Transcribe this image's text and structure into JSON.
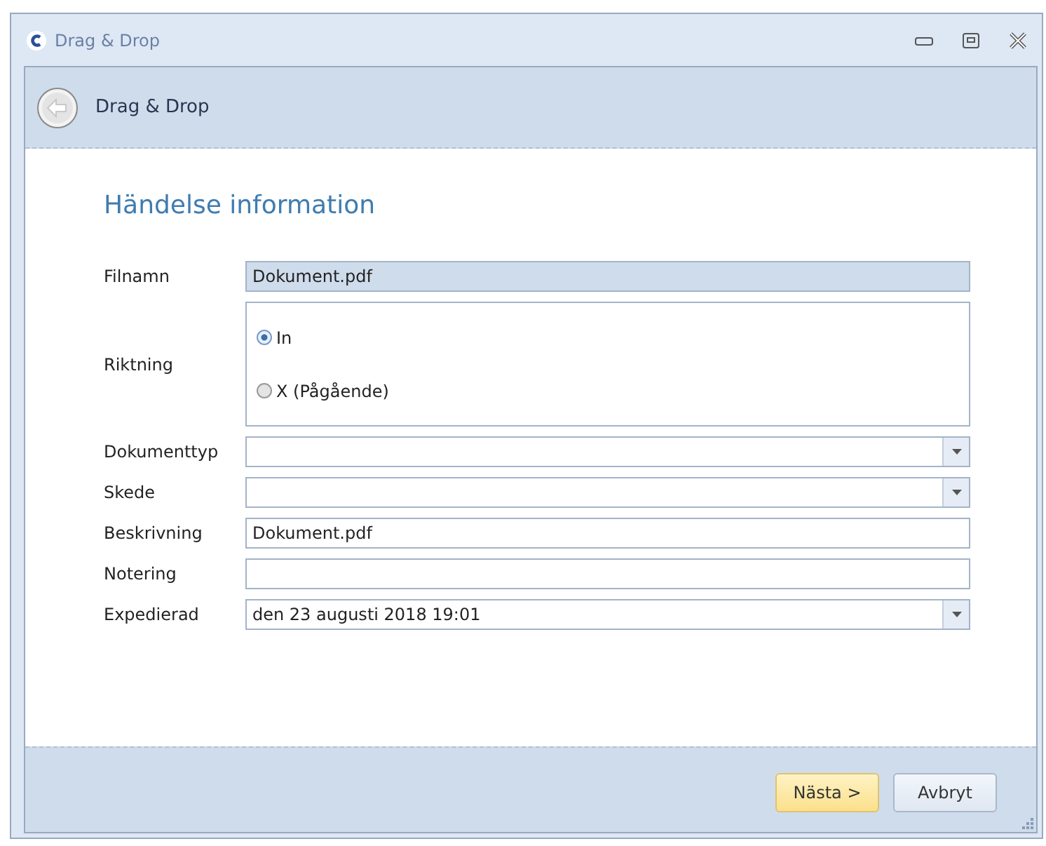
{
  "window": {
    "title": "Drag & Drop"
  },
  "header": {
    "title": "Drag & Drop"
  },
  "section_title": "Händelse information",
  "fields": [
    {
      "label": "Filnamn",
      "kind": "readonly",
      "value": "Dokument.pdf"
    },
    {
      "label": "Riktning",
      "kind": "radio",
      "options": [
        {
          "label": "In",
          "selected": true
        },
        {
          "label": "X (Pågående)",
          "selected": false
        }
      ]
    },
    {
      "label": "Dokumenttyp",
      "kind": "dropdown"
    },
    {
      "label": "Skede",
      "kind": "dropdown"
    },
    {
      "label": "Beskrivning",
      "kind": "text",
      "value": "Dokument.pdf"
    },
    {
      "label": "Notering",
      "kind": "text"
    },
    {
      "label": "Expedierad",
      "kind": "dropdown",
      "value": "den 23 augusti 2018 19:01"
    }
  ],
  "buttons": [
    {
      "label": "Nästa >",
      "kind": "primary"
    },
    {
      "label": "Avbryt",
      "kind": "secondary"
    }
  ]
}
